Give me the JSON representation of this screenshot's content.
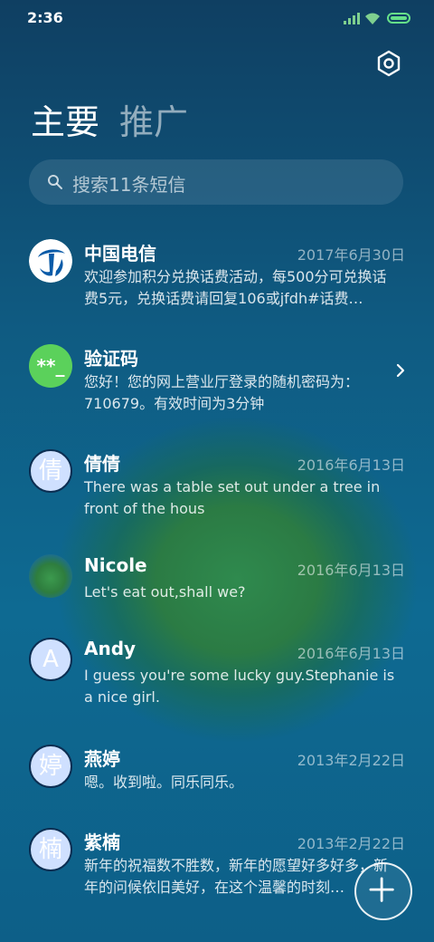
{
  "status_bar": {
    "time": "2:36"
  },
  "tabs": [
    {
      "label": "主要"
    },
    {
      "label": "推广"
    }
  ],
  "search": {
    "placeholder": "搜索11条短信"
  },
  "conversations": [
    {
      "name": "中国电信",
      "date": "2017年6月30日",
      "preview": "欢迎参加积分兑换话费活动，每500分可兑换话费5元，兑换话费请回复106或jfdh#话费…",
      "avatar": "china-telecom-logo"
    },
    {
      "name": "验证码",
      "date": "",
      "preview": "您好！您的网上营业厅登录的随机密码为：710679。有效时间为3分钟",
      "avatar_text": "**_"
    },
    {
      "name": "倩倩",
      "date": "2016年6月13日",
      "preview": "There was a table set out under a tree in front of the hous",
      "avatar_text": "倩"
    },
    {
      "name": "Nicole",
      "date": "2016年6月13日",
      "preview": "Let's eat out,shall we?",
      "avatar": "photo-avatar"
    },
    {
      "name": "Andy",
      "date": "2016年6月13日",
      "preview": "I guess you're some lucky guy.Stephanie is a nice girl.",
      "avatar_text": "A"
    },
    {
      "name": "燕婷",
      "date": "2013年2月22日",
      "preview": "嗯。收到啦。同乐同乐。",
      "avatar_text": "婷"
    },
    {
      "name": "紫楠",
      "date": "2013年2月22日",
      "preview": "新年的祝福数不胜数，新年的愿望好多好多，新年的问候依旧美好，在这个温馨的时刻…",
      "avatar_text": "楠"
    }
  ],
  "colors": {
    "accent_green": "#66e089",
    "verification_avatar": "#5bd15b",
    "letter_avatar": "#cfe0ff"
  }
}
